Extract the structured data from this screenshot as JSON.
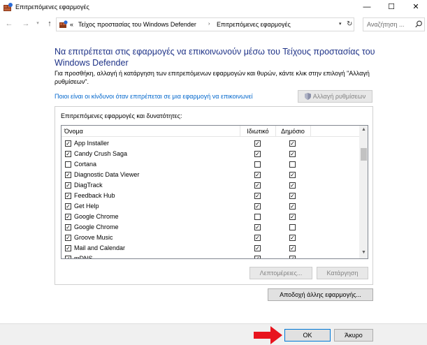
{
  "window": {
    "title": "Επιτρεπόμενες εφαρμογές",
    "minimize": "—",
    "maximize": "☐",
    "close": "✕"
  },
  "address_bar": {
    "prefix": "«",
    "segments": [
      "Τείχος προστασίας του Windows Defender",
      "Επιτρεπόμενες εφαρμογές"
    ],
    "search_placeholder": "Αναζήτηση ..."
  },
  "content": {
    "heading": "Να επιτρέπεται στις εφαρμογές να επικοινωνούν μέσω του Τείχους προστασίας του Windows Defender",
    "description": "Για προσθήκη, αλλαγή ή κατάργηση των επιτρεπόμενων εφαρμογών και θυρών, κάντε κλικ στην επιλογή \"Αλλαγή ρυθμίσεων\".",
    "risk_link": "Ποιοι είναι οι κίνδυνοι όταν επιτρέπεται σε μια εφαρμογή να επικοινωνεί",
    "change_settings": "Αλλαγή ρυθμίσεων",
    "group_title": "Επιτρεπόμενες εφαρμογές και δυνατότητες:",
    "columns": {
      "name": "Όνομα",
      "private": "Ιδιωτικό",
      "public": "Δημόσιο"
    },
    "apps": [
      {
        "name": "App Installer",
        "enabled": true,
        "private": true,
        "public": true
      },
      {
        "name": "Candy Crush Saga",
        "enabled": true,
        "private": true,
        "public": true
      },
      {
        "name": "Cortana",
        "enabled": false,
        "private": false,
        "public": false
      },
      {
        "name": "Diagnostic Data Viewer",
        "enabled": true,
        "private": true,
        "public": true
      },
      {
        "name": "DiagTrack",
        "enabled": true,
        "private": true,
        "public": true
      },
      {
        "name": "Feedback Hub",
        "enabled": true,
        "private": true,
        "public": true
      },
      {
        "name": "Get Help",
        "enabled": true,
        "private": true,
        "public": true
      },
      {
        "name": "Google Chrome",
        "enabled": true,
        "private": false,
        "public": true
      },
      {
        "name": "Google Chrome",
        "enabled": true,
        "private": true,
        "public": false
      },
      {
        "name": "Groove Music",
        "enabled": true,
        "private": true,
        "public": true
      },
      {
        "name": "Mail and Calendar",
        "enabled": true,
        "private": true,
        "public": true
      },
      {
        "name": "mDNS",
        "enabled": true,
        "private": true,
        "public": true
      }
    ],
    "details_button": "Λεπτομέρειες...",
    "remove_button": "Κατάργηση",
    "allow_another_button": "Αποδοχή άλλης εφαρμογής..."
  },
  "footer": {
    "ok": "OK",
    "cancel": "Άκυρο"
  },
  "colors": {
    "heading": "#1e3287",
    "link": "#0066cc",
    "annotation_arrow": "#e8141e",
    "ok_border": "#0078d7"
  }
}
